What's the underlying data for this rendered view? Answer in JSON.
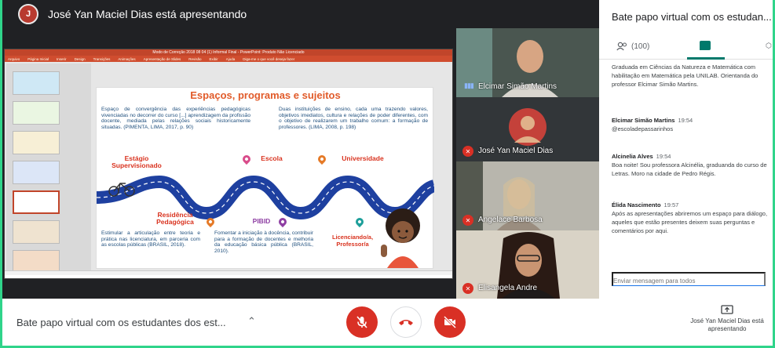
{
  "presenter": {
    "title": "José Yan Maciel Dias está apresentando",
    "avatar": "avatar-icon"
  },
  "ppt": {
    "window_title": "Modo de Correção 2018 08 04 (1) Informal Final - PowerPoint: Produto Não Licenciado",
    "ribbon": [
      "Arquivo",
      "Página Inicial",
      "Inserir",
      "Design",
      "Transições",
      "Animações",
      "Apresentação de Slides",
      "Revisão",
      "Exibir",
      "Ajuda",
      "Diga-me o que você deseja fazer"
    ]
  },
  "slide": {
    "title": "Espaços, programas e sujeitos",
    "text_left": "Espaço de convergência das experiências pedagógicas vivenciadas no decorrer do curso [...] aprendizagem da profissão docente, mediada pelas relações sociais historicamente situadas. (PIMENTA, LIMA, 2017, p. 90)",
    "text_right": "Duas instituições de ensino, cada uma trazendo valores, objetivos imediatos, cultura e relações de poder diferentes, com o objetivo de realizarem um trabalho comum: a formação de professores. (LIMA, 2008, p. 198)",
    "label_estagio": "Estágio Supervisionado",
    "label_escola": "Escola",
    "label_universidade": "Universidade",
    "label_residencia": "Residência Pedagógica",
    "label_pibid": "PIBID",
    "label_licenciando": "Licenciando/a, Professor/a",
    "text_residencia": "Estimular a articulação entre teoria e prática nas licenciatura, em parceria com as escolas públicas (BRASIL, 2018).",
    "text_pibid": "Fomentar a iniciação à docência, contribuir para a formação de docentes e melhoria da educação básica pública (BRASIL, 2010)."
  },
  "participants": [
    {
      "name": "Elcimar Simão Martins",
      "state": "speaking"
    },
    {
      "name": "José Yan Maciel Dias",
      "state": "muted"
    },
    {
      "name": "Angelace Barbosa",
      "state": "muted"
    },
    {
      "name": "Elisangela Andre",
      "state": "muted"
    }
  ],
  "chat": {
    "title": "Bate papo virtual com os estudan...",
    "people_count": "(100)",
    "messages": [
      {
        "author": "",
        "time": "",
        "text": "Graduada em Ciências da Natureza e Matemática com habilitação em Matemática pela UNILAB. Orientanda do professor Elcimar Simão Martins."
      },
      {
        "author": "Elcimar Simão Martins",
        "time": "19:54",
        "text": "@escoladepassarinhos"
      },
      {
        "author": "Alcinelia Alves",
        "time": "19:54",
        "text": "Boa noite! Sou professora Alcinélia, graduanda do curso de Letras. Moro na cidade de Pedro Régis."
      },
      {
        "author": "Élida Nascimento",
        "time": "19:57",
        "text": "Após as apresentações abriremos um espaço para diálogo, aqueles que estão presentes deixem suas perguntas e comentários por aqui."
      }
    ],
    "input_placeholder": "Enviar mensagem para todos"
  },
  "bottom": {
    "meeting_title": "Bate papo virtual com os estudantes dos est...",
    "presenting_label": "José Yan Maciel Dias está apresentando"
  },
  "colors": {
    "accent": "#00796b",
    "danger": "#d93025",
    "slide_orange": "#e15b2a",
    "road": "#1e40a0"
  }
}
